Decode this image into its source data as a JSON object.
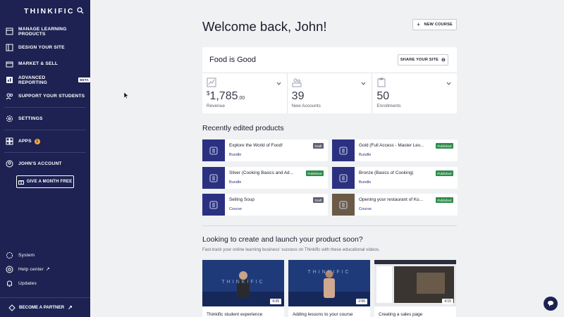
{
  "sidebar": {
    "logo": "THINKIFIC",
    "items": [
      {
        "label": "MANAGE LEARNING PRODUCTS"
      },
      {
        "label": "DESIGN YOUR SITE"
      },
      {
        "label": "MARKET & SELL"
      },
      {
        "label": "ADVANCED REPORTING",
        "badge": "BETA"
      },
      {
        "label": "SUPPORT YOUR STUDENTS"
      },
      {
        "label": "SETTINGS"
      },
      {
        "label": "APPS",
        "badge": "1"
      },
      {
        "label": "JOHN'S ACCOUNT"
      }
    ],
    "give_button": "GIVE A MONTH FREE",
    "bottom": [
      {
        "label": "System"
      },
      {
        "label": "Help center"
      },
      {
        "label": "Updates"
      }
    ],
    "partner": "BECOME A PARTNER"
  },
  "header": {
    "welcome": "Welcome back, John!",
    "new_course": "NEW COURSE"
  },
  "site_card": {
    "title": "Food is Good",
    "share_button": "SHARE YOUR SITE",
    "stats": [
      {
        "currency": "$",
        "value": "1,785",
        "cents": ".00",
        "label": "Revenue"
      },
      {
        "value": "39",
        "label": "New Accounts"
      },
      {
        "value": "50",
        "label": "Enrollments"
      }
    ]
  },
  "recent": {
    "title": "Recently edited products",
    "products": [
      {
        "name": "Explore the World of Food!",
        "type": "Bundle",
        "status": "Draft"
      },
      {
        "name": "Gold (Full Access - Master Lev...",
        "type": "Bundle",
        "status": "Published"
      },
      {
        "name": "Silver (Cooking Basics and Ad...",
        "type": "Bundle",
        "status": "Published"
      },
      {
        "name": "Bronze (Basics of Cooking)",
        "type": "Bundle",
        "status": "Published"
      },
      {
        "name": "Selling Soup",
        "type": "Course",
        "status": "Draft"
      },
      {
        "name": "Opening your restaurant of Ko...",
        "type": "Course",
        "status": "Published"
      }
    ]
  },
  "launch": {
    "title": "Looking to create and launch your product soon?",
    "subtitle": "Fast-track your online learning business' success on Thinkific with these educational videos.",
    "videos": [
      {
        "title": "Thinkific student experience",
        "duration": "4:35",
        "brand": "THINKIFIC"
      },
      {
        "title": "Adding lessons to your course",
        "duration": "2:56",
        "brand": "THINKIFIC"
      },
      {
        "title": "Creating a sales page",
        "duration": "4:15"
      }
    ]
  },
  "colors": {
    "sidebar": "#1d2252",
    "accent": "#2b3180",
    "published": "#2e8c4a",
    "draft": "#5f6170"
  }
}
